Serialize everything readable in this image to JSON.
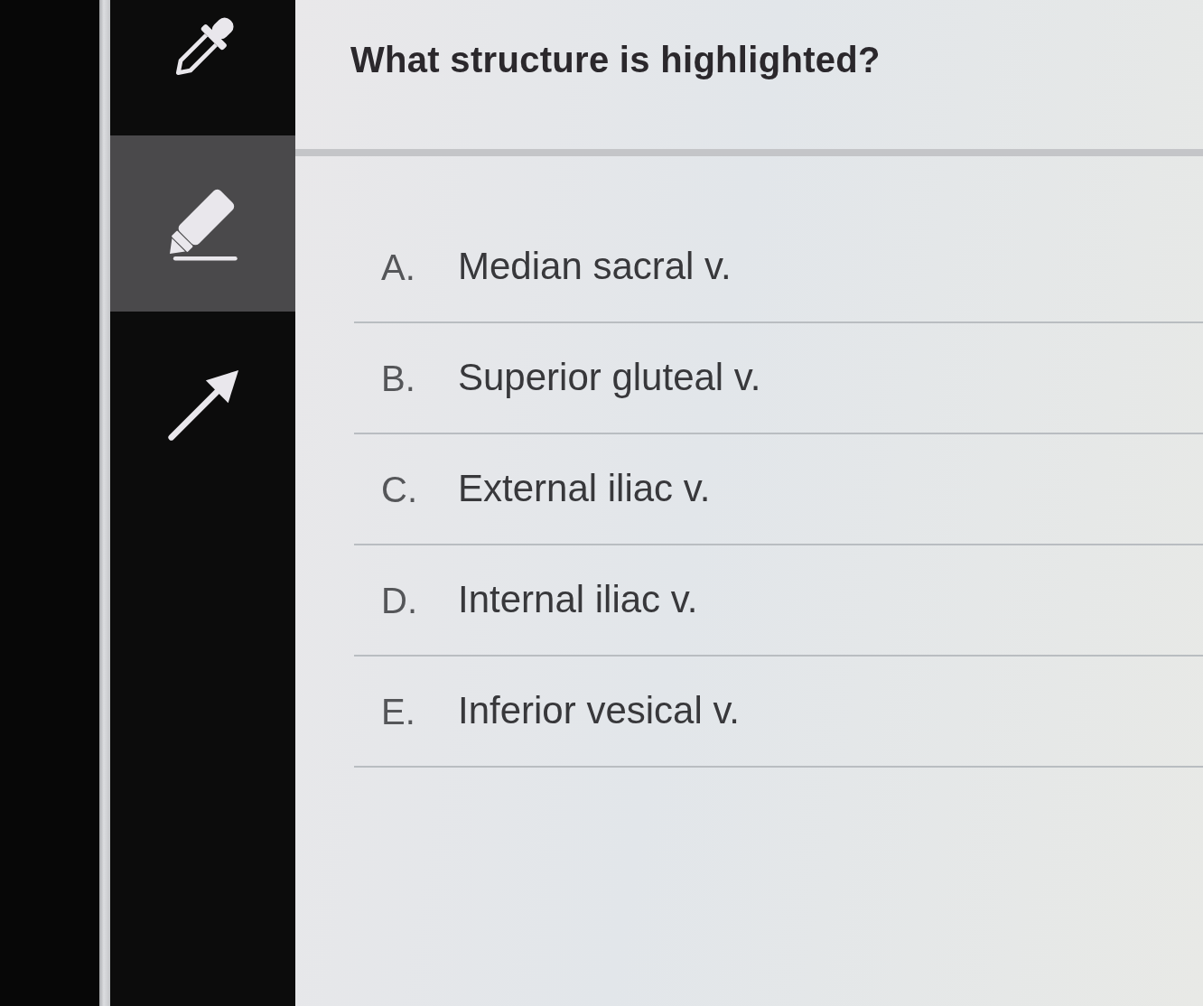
{
  "toolbar": {
    "tools": [
      {
        "kind": "dropper",
        "selected": false
      },
      {
        "kind": "highlighter",
        "selected": true
      },
      {
        "kind": "arrow",
        "selected": false
      }
    ]
  },
  "question": {
    "text": "What structure is highlighted?"
  },
  "options": [
    {
      "letter": "A.",
      "text": "Median sacral v."
    },
    {
      "letter": "B.",
      "text": "Superior gluteal v."
    },
    {
      "letter": "C.",
      "text": "External iliac v."
    },
    {
      "letter": "D.",
      "text": "Internal iliac v."
    },
    {
      "letter": "E.",
      "text": "Inferior vesical v."
    }
  ]
}
